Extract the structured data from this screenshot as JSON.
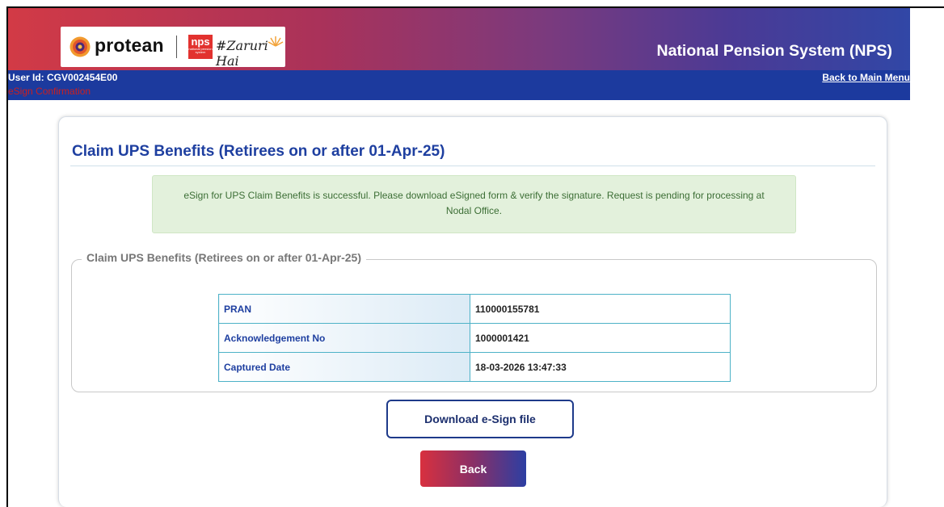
{
  "brand": {
    "company": "protean",
    "nps_badge": "nps",
    "nps_badge_sub": "national pension system",
    "tagline": "#Zaruri Hai"
  },
  "header": {
    "title": "National Pension System (NPS)"
  },
  "userbar": {
    "user_id": "User Id: CGV002454E00",
    "breadcrumb": "eSign Confirmation",
    "back_to_menu": "Back to Main Menu"
  },
  "page": {
    "title": "Claim UPS Benefits (Retirees on or after 01-Apr-25)",
    "success_message": "eSign for UPS Claim Benefits is successful. Please download eSigned form & verify the signature. Request is pending for processing at Nodal Office.",
    "fieldset_legend": "Claim UPS Benefits (Retirees on or after 01-Apr-25)"
  },
  "details": [
    {
      "label": "PRAN",
      "value": "110000155781"
    },
    {
      "label": "Acknowledgement No",
      "value": "1000001421"
    },
    {
      "label": "Captured Date",
      "value": "18-03-2026 13:47:33"
    }
  ],
  "actions": {
    "download_label": "Download e-Sign file",
    "back_label": "Back"
  },
  "colors": {
    "header_gradient_start": "#d23a46",
    "header_gradient_end": "#3147a6",
    "userbar": "#1c3a9e",
    "title": "#1e3fa0",
    "success_bg": "#e3f1dc",
    "success_text": "#3c6e35",
    "table_border": "#4db2c7"
  }
}
